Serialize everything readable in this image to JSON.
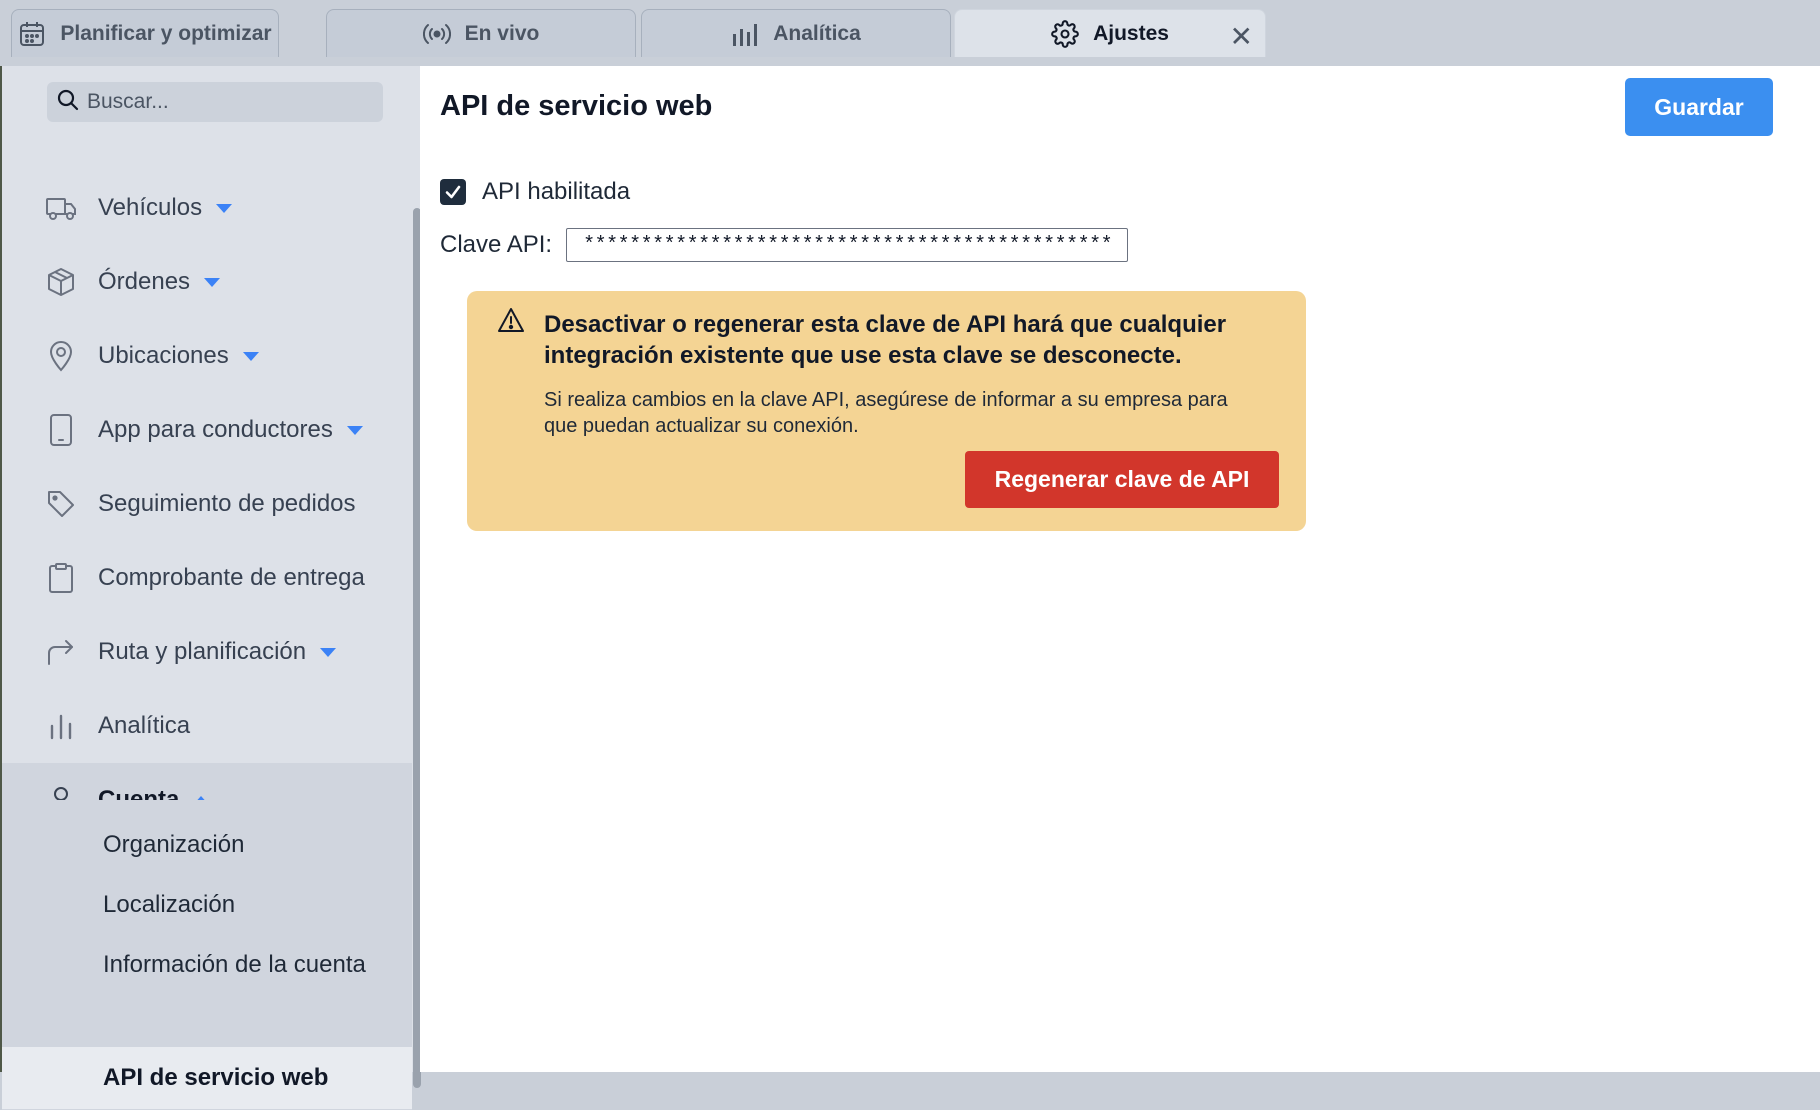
{
  "tabs": [
    {
      "label": "Planificar y optimizar",
      "icon": "calendar-icon"
    },
    {
      "label": "En vivo",
      "icon": "broadcast-icon"
    },
    {
      "label": "Analítica",
      "icon": "bar-chart-icon"
    },
    {
      "label": "Ajustes",
      "icon": "gear-icon",
      "active": true,
      "close_label": "✕"
    }
  ],
  "sidebar": {
    "search_placeholder": "Buscar...",
    "items": [
      {
        "label": "Vehículos",
        "icon": "truck-icon",
        "expandable": true
      },
      {
        "label": "Órdenes",
        "icon": "package-icon",
        "expandable": true
      },
      {
        "label": "Ubicaciones",
        "icon": "map-pin-icon",
        "expandable": true
      },
      {
        "label": "App para conductores",
        "icon": "phone-icon",
        "expandable": true
      },
      {
        "label": "Seguimiento de pedidos",
        "icon": "tag-icon",
        "expandable": false
      },
      {
        "label": "Comprobante de entrega",
        "icon": "clipboard-icon",
        "expandable": false
      },
      {
        "label": "Ruta y planificación",
        "icon": "route-arrow-icon",
        "expandable": true
      },
      {
        "label": "Analítica",
        "icon": "bar-chart-icon",
        "expandable": false
      },
      {
        "label": "Cuenta",
        "icon": "user-icon",
        "expandable": true,
        "expanded": true
      }
    ],
    "account_sub_items": [
      {
        "label": "Organización"
      },
      {
        "label": "Localización"
      },
      {
        "label": "Información de la cuenta"
      },
      {
        "label": "API de servicio web",
        "active": true
      }
    ]
  },
  "main": {
    "title": "API de servicio web",
    "save_label": "Guardar",
    "api_enabled_label": "API habilitada",
    "api_enabled": true,
    "api_key_label": "Clave API:",
    "api_key_value": "************************************************",
    "warning": {
      "title": "Desactivar o regenerar esta clave de API hará que cualquier integración existente que use esta clave se desconecte.",
      "body": "Si realiza cambios en la clave API, asegúrese de informar a su empresa para que puedan actualizar su conexión.",
      "button_label": "Regenerar clave de API"
    }
  },
  "colors": {
    "primary_button": "#3b8ff0",
    "danger_button": "#d2362b",
    "warning_bg": "#f4d494",
    "caret": "#3b82f6"
  }
}
